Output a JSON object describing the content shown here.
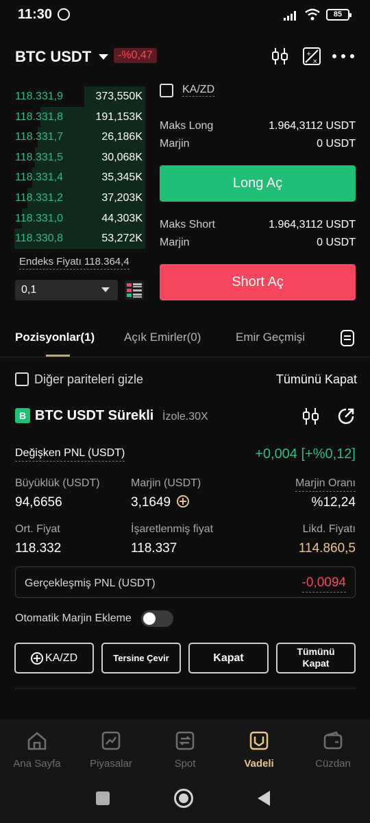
{
  "status_bar": {
    "time": "11:30",
    "battery": "85"
  },
  "header": {
    "pair": "BTC USDT",
    "change": "-%0,47"
  },
  "order_book": {
    "rows": [
      {
        "price": "118.331,9",
        "qty": "373,550K",
        "depth": 0.42
      },
      {
        "price": "118.331,8",
        "qty": "191,153K",
        "depth": 0.72
      },
      {
        "price": "118.331,7",
        "qty": "26,186K",
        "depth": 0.74
      },
      {
        "price": "118.331,5",
        "qty": "30,068K",
        "depth": 0.76
      },
      {
        "price": "118.331,4",
        "qty": "35,345K",
        "depth": 0.78
      },
      {
        "price": "118.331,2",
        "qty": "37,203K",
        "depth": 0.81
      },
      {
        "price": "118.331,0",
        "qty": "44,303K",
        "depth": 0.85
      },
      {
        "price": "118.330,8",
        "qty": "53,272K",
        "depth": 0.9
      }
    ],
    "index_price": "Endeks Fiyatı 118.364,4",
    "quantity_step": "0,1"
  },
  "trade": {
    "ka_zd": "KA/ZD",
    "max_long_label": "Maks Long",
    "max_long_value": "1.964,3112 USDT",
    "margin_label": "Marjin",
    "margin_long_value": "0 USDT",
    "long_button": "Long Aç",
    "max_short_label": "Maks Short",
    "max_short_value": "1.964,3112 USDT",
    "margin_short_value": "0 USDT",
    "short_button": "Short Aç"
  },
  "tabs": {
    "positions": "Pozisyonlar(1)",
    "open_orders": "Açık Emirler(0)",
    "order_history": "Emir Geçmişi"
  },
  "positions": {
    "hide_other": "Diğer pariteleri gizle",
    "close_all": "Tümünü Kapat",
    "badge": "B",
    "symbol": "BTC USDT Sürekli",
    "mode": "İzole.30X",
    "unrealized_pnl_label": "Değişken PNL (USDT)",
    "unrealized_pnl_value": "+0,004 [+%0,12]",
    "size_label": "Büyüklük (USDT)",
    "size_value": "94,6656",
    "margin_label": "Marjin (USDT)",
    "margin_value": "3,1649",
    "margin_ratio_label": "Marjin Oranı",
    "margin_ratio_value": "%12,24",
    "avg_price_label": "Ort. Fiyat",
    "avg_price_value": "118.332",
    "mark_price_label": "İşaretlenmiş fiyat",
    "mark_price_value": "118.337",
    "liq_price_label": "Likd. Fiyatı",
    "liq_price_value": "114.860,5",
    "realized_pnl_label": "Gerçekleşmiş PNL (USDT)",
    "realized_pnl_value": "-0,0094",
    "auto_margin_label": "Otomatik Marjin Ekleme",
    "btn_ka_zd": "KA/ZD",
    "btn_reverse": "Tersine Çevir",
    "btn_close": "Kapat",
    "btn_close_all": "Tümünü Kapat"
  },
  "bottom_nav": {
    "home": "Ana Sayfa",
    "markets": "Piyasalar",
    "spot": "Spot",
    "futures": "Vadeli",
    "wallet": "Cüzdan"
  }
}
